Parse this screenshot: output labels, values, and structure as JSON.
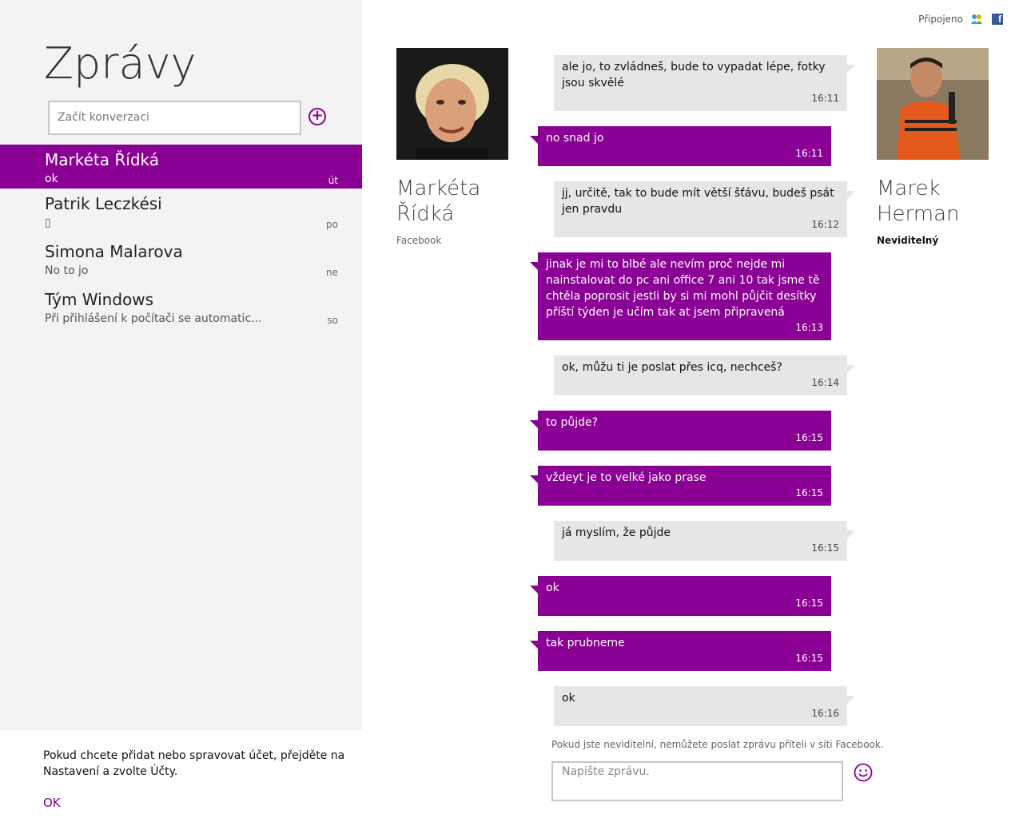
{
  "left": {
    "title": "Zprávy",
    "new_conversation_placeholder": "Začít konverzaci",
    "conversations": [
      {
        "name": "Markéta Řídká",
        "preview": "ok",
        "day": "út"
      },
      {
        "name": "Patrik Leczkési",
        "preview": "▯",
        "day": "po"
      },
      {
        "name": "Simona Malarova",
        "preview": "No to jo",
        "day": "ne"
      },
      {
        "name": "Tým Windows",
        "preview": "Při přihlášení k počítači se automatic...",
        "day": "so"
      }
    ],
    "notice": {
      "text": "Pokud chcete přidat nebo spravovat účet, přejděte na Nastavení a zvolte Účty.",
      "ok": "OK"
    }
  },
  "header": {
    "status": "Připojeno"
  },
  "contact_left": {
    "name": "Markéta Řídká",
    "network": "Facebook"
  },
  "contact_right": {
    "name": "Marek Herman",
    "status": "Neviditelný"
  },
  "messages": [
    {
      "dir": "in",
      "text": "ale jo, to zvládneš, bude to vypadat lépe, fotky jsou skvělé",
      "time": "16:11"
    },
    {
      "dir": "out",
      "text": "no snad jo",
      "time": "16:11"
    },
    {
      "dir": "in",
      "text": "jj, určitě, tak to bude mít větší šťávu, budeš psát jen pravdu",
      "time": "16:12"
    },
    {
      "dir": "out",
      "text": "jinak je mi to blbé ale nevím proč nejde mi nainstalovat do pc ani office 7 ani 10 tak jsme tě chtěla poprosit jestli by si mi mohl půjčit desítky příští týden je učím tak at jsem připravená",
      "time": "16:13"
    },
    {
      "dir": "in",
      "text": "ok, můžu ti je poslat přes icq, nechceš?",
      "time": "16:14"
    },
    {
      "dir": "out",
      "text": "to půjde?",
      "time": "16:15"
    },
    {
      "dir": "out",
      "text": "vždeyt je to velké jako prase",
      "time": "16:15"
    },
    {
      "dir": "in",
      "text": "já myslím, že půjde",
      "time": "16:15"
    },
    {
      "dir": "out",
      "text": "ok",
      "time": "16:15"
    },
    {
      "dir": "out",
      "text": "tak prubneme",
      "time": "16:15"
    },
    {
      "dir": "in",
      "text": "ok",
      "time": "16:16"
    }
  ],
  "compose": {
    "note": "Pokud jste neviditelní, nemůžete poslat zprávu příteli v síti Facebook.",
    "placeholder": "Napište zprávu."
  },
  "colors": {
    "accent": "#8a0094",
    "incoming_bubble": "#e6e6e6",
    "sidebar_bg": "#f3f3f3"
  }
}
